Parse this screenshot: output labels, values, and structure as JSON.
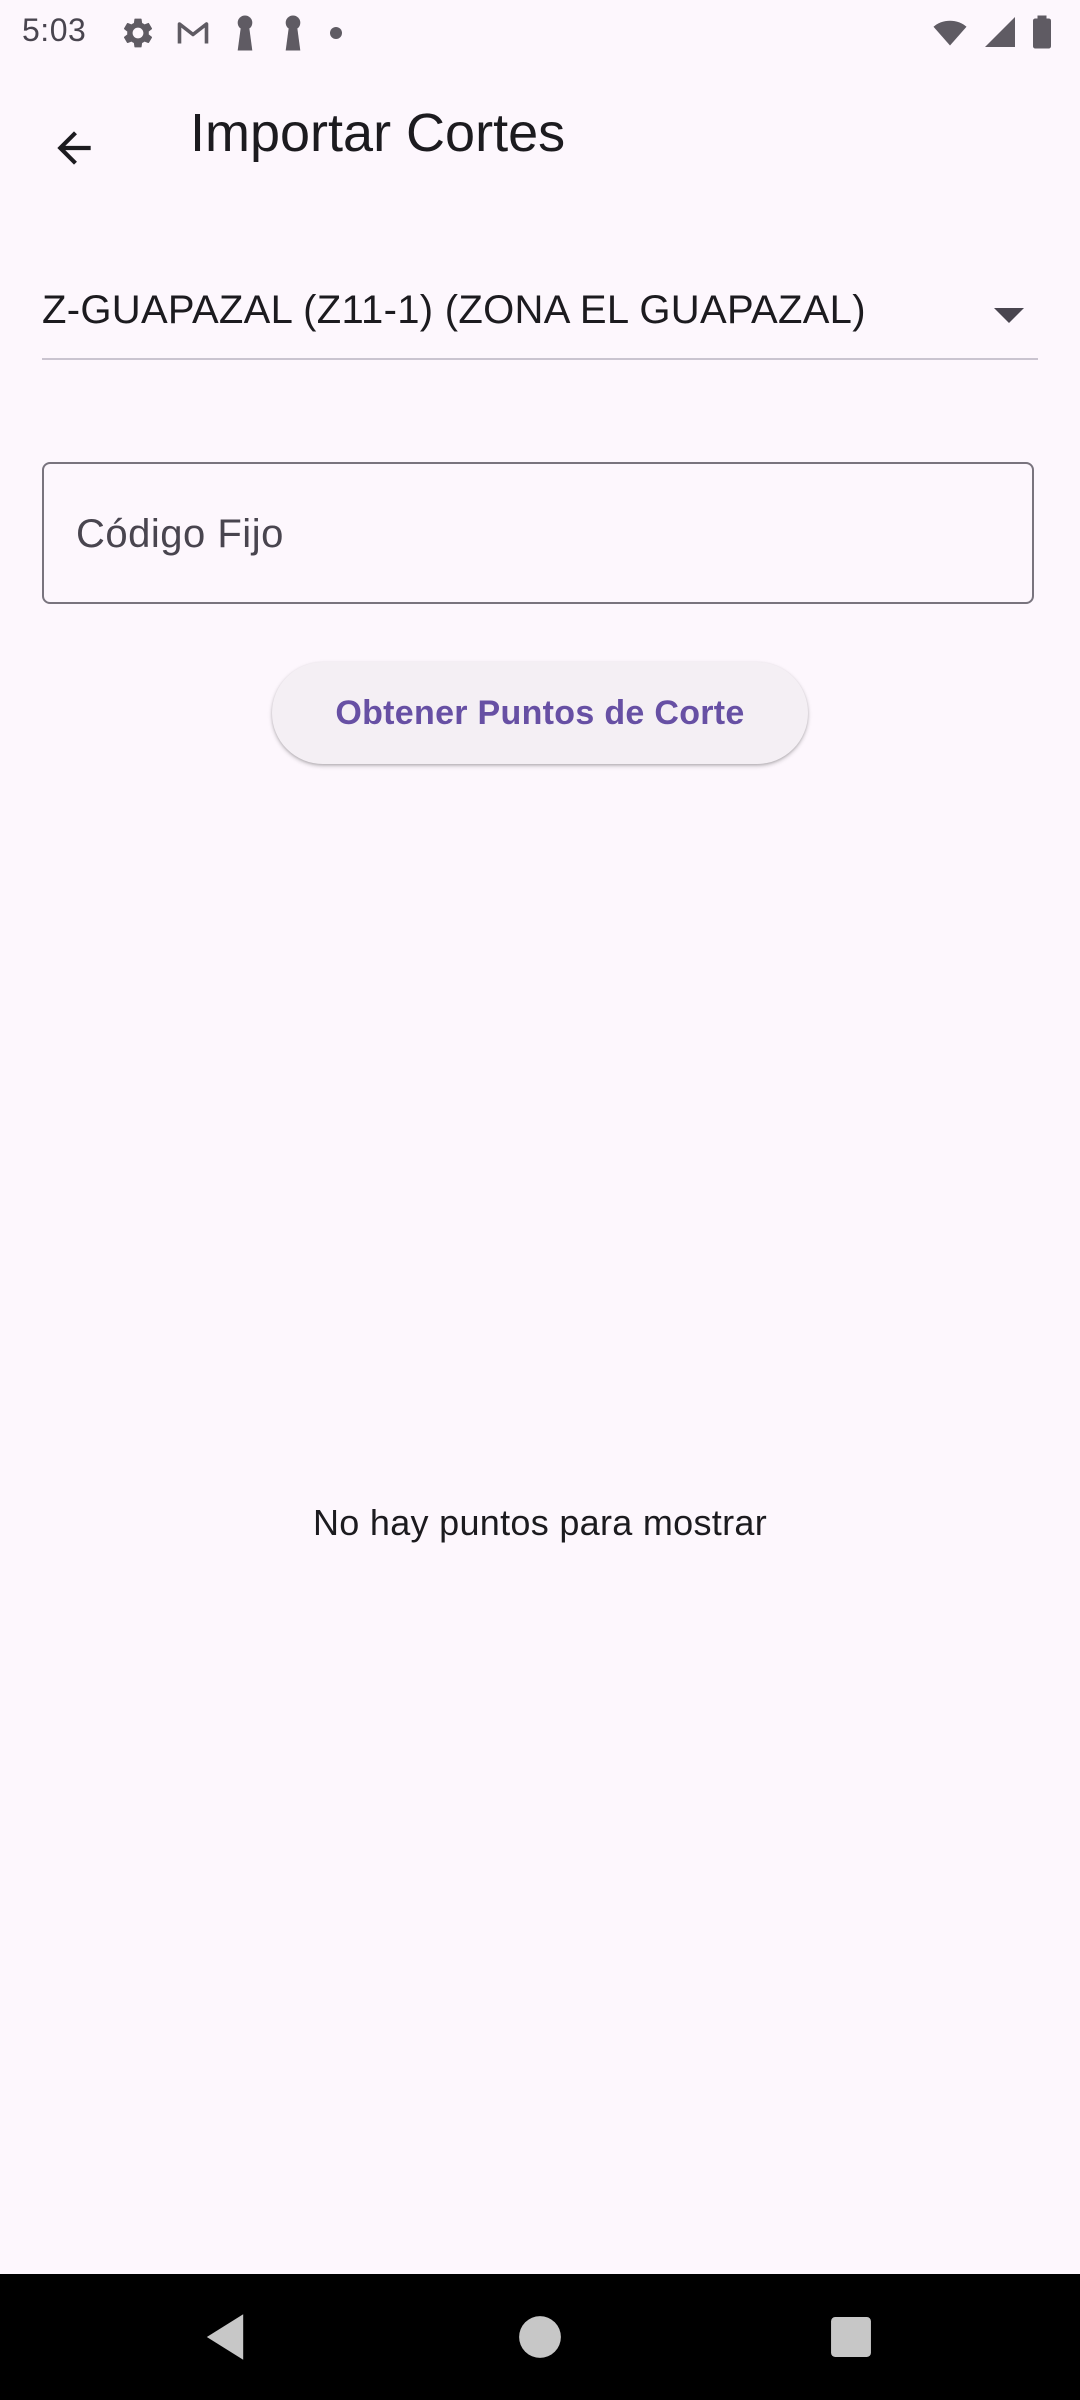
{
  "status_bar": {
    "time": "5:03",
    "left_icons": [
      "settings-icon",
      "gmail-icon",
      "key-icon",
      "key-icon",
      "dot-icon"
    ],
    "right_icons": [
      "wifi-icon",
      "signal-icon",
      "battery-icon"
    ]
  },
  "app_bar": {
    "title": "Importar Cortes",
    "back_icon": "arrow-back-icon"
  },
  "zone_dropdown": {
    "selected_value": "Z-GUAPAZAL (Z11-1) (ZONA EL GUAPAZAL)",
    "icon": "arrow-drop-down-icon"
  },
  "code_field": {
    "placeholder": "Código Fijo",
    "value": ""
  },
  "action_button": {
    "label": "Obtener Puntos de Corte"
  },
  "empty_state": {
    "message": "No hay puntos para mostrar"
  },
  "nav_bar": {
    "icons": [
      "nav-back-icon",
      "nav-home-icon",
      "nav-recents-icon"
    ]
  },
  "colors": {
    "background": "#fdf7fd",
    "primary": "#6750a4",
    "button_surface": "#f4eff4",
    "outline": "#79747e",
    "on_surface": "#1c1b1f"
  }
}
